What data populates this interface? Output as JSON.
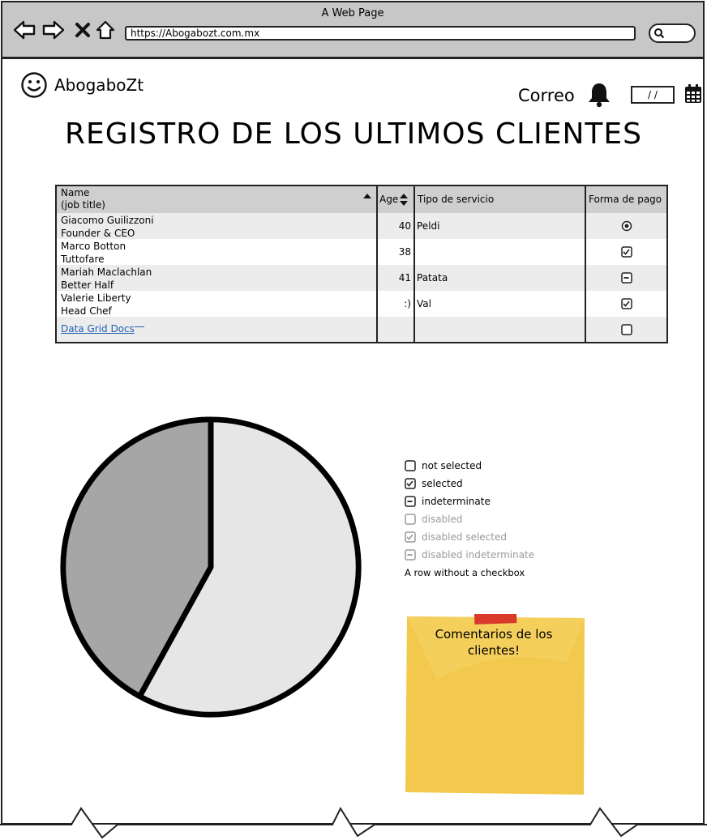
{
  "window": {
    "title": "A Web Page",
    "url": "https://Abogabozt.com.mx"
  },
  "nav": {
    "icons": [
      "back-arrow-icon",
      "forward-arrow-icon",
      "close-icon",
      "home-icon",
      "search-icon"
    ]
  },
  "header": {
    "logo_text": "AbogaboZt",
    "mail_label": "Correo",
    "date_value": "/ /"
  },
  "page": {
    "title": "REGISTRO DE LOS ULTIMOS CLIENTES"
  },
  "table": {
    "columns": [
      "Name\n(job title)",
      "Age",
      "Tipo de servicio",
      "Forma de pago"
    ],
    "col_name_line1": "Name",
    "col_name_line2": "(job title)",
    "rows": [
      {
        "name": "Giacomo Guilizzoni",
        "title": "Founder & CEO",
        "age": "40",
        "service": "Peldi",
        "payment": "radio"
      },
      {
        "name": "Marco Botton",
        "title": "Tuttofare",
        "age": "38",
        "service": "",
        "payment": "checked"
      },
      {
        "name": "Mariah Maclachlan",
        "title": "Better Half",
        "age": "41",
        "service": "Patata",
        "payment": "indeterminate"
      },
      {
        "name": "Valerie Liberty",
        "title": "Head Chef",
        "age": ":)",
        "service": "Val",
        "payment": "checked"
      }
    ],
    "footer_link": "Data Grid Docs",
    "footer_payment": "unchecked"
  },
  "chart_data": {
    "type": "pie",
    "values": [
      58,
      42
    ],
    "colors": [
      "#e6e6e6",
      "#a6a6a6"
    ]
  },
  "legend": {
    "items": [
      {
        "label": "not selected",
        "state": "unchecked",
        "disabled": false
      },
      {
        "label": "selected",
        "state": "checked",
        "disabled": false
      },
      {
        "label": "indeterminate",
        "state": "indeterminate",
        "disabled": false
      },
      {
        "label": "disabled",
        "state": "unchecked",
        "disabled": true
      },
      {
        "label": "disabled selected",
        "state": "checked",
        "disabled": true
      },
      {
        "label": "disabled indeterminate",
        "state": "indeterminate",
        "disabled": true
      }
    ],
    "plain_row": "A row without a checkbox"
  },
  "note": {
    "text": "Comentarios de los clientes!"
  },
  "colors": {
    "chrome": "#c7c7c7",
    "note": "#f2c94c",
    "tape": "#d93a2b",
    "link": "#1f5fb5"
  }
}
